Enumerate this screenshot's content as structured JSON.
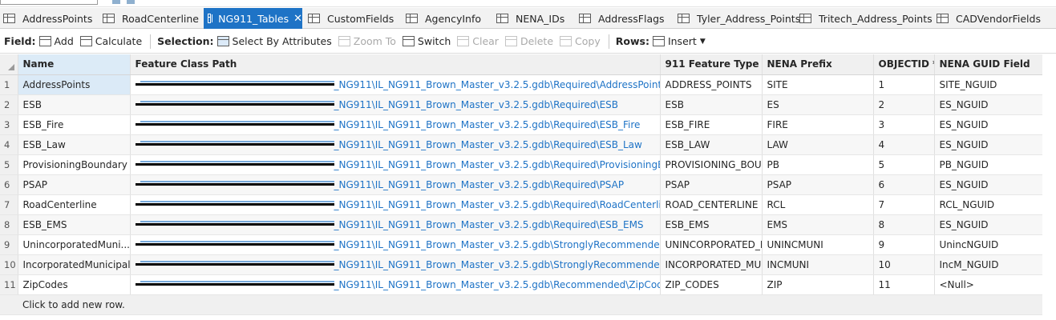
{
  "tabs": [
    {
      "label": "AddressPoints",
      "active": false
    },
    {
      "label": "RoadCenterline",
      "active": false
    },
    {
      "label": "NG911_Tables",
      "active": true,
      "close": "✕"
    },
    {
      "label": "CustomFields",
      "active": false
    },
    {
      "label": "AgencyInfo",
      "active": false
    },
    {
      "label": "NENA_IDs",
      "active": false
    },
    {
      "label": "AddressFlags",
      "active": false
    },
    {
      "label": "Tyler_Address_Points",
      "active": false
    },
    {
      "label": "Tritech_Address_Points",
      "active": false
    },
    {
      "label": "CADVendorFields",
      "active": false
    }
  ],
  "toolbar": {
    "field_label": "Field:",
    "add": "Add",
    "calculate": "Calculate",
    "selection_label": "Selection:",
    "select_by_attributes": "Select By Attributes",
    "zoom_to": "Zoom To",
    "switch": "Switch",
    "clear": "Clear",
    "delete": "Delete",
    "copy": "Copy",
    "rows_label": "Rows:",
    "insert": "Insert"
  },
  "columns": [
    "Name",
    "Feature Class Path",
    "911 Feature Type",
    "NENA Prefix",
    "OBJECTID *",
    "NENA GUID Field"
  ],
  "rows": [
    {
      "n": "1",
      "name": "AddressPoints",
      "path": "_NG911\\IL_NG911_Brown_Master_v3.2.5.gdb\\Required\\AddressPoints",
      "type": "ADDRESS_POINTS",
      "prefix": "SITE",
      "oid": "1",
      "guid": "SITE_NGUID"
    },
    {
      "n": "2",
      "name": "ESB",
      "path": "_NG911\\IL_NG911_Brown_Master_v3.2.5.gdb\\Required\\ESB",
      "type": "ESB",
      "prefix": "ES",
      "oid": "2",
      "guid": "ES_NGUID"
    },
    {
      "n": "3",
      "name": "ESB_Fire",
      "path": "_NG911\\IL_NG911_Brown_Master_v3.2.5.gdb\\Required\\ESB_Fire",
      "type": "ESB_FIRE",
      "prefix": "FIRE",
      "oid": "3",
      "guid": "ES_NGUID"
    },
    {
      "n": "4",
      "name": "ESB_Law",
      "path": "_NG911\\IL_NG911_Brown_Master_v3.2.5.gdb\\Required\\ESB_Law",
      "type": "ESB_LAW",
      "prefix": "LAW",
      "oid": "4",
      "guid": "ES_NGUID"
    },
    {
      "n": "5",
      "name": "ProvisioningBoundary",
      "path": "_NG911\\IL_NG911_Brown_Master_v3.2.5.gdb\\Required\\ProvisioningBounda",
      "type": "PROVISIONING_BOUNE",
      "prefix": "PB",
      "oid": "5",
      "guid": "PB_NGUID"
    },
    {
      "n": "6",
      "name": "PSAP",
      "path": "_NG911\\IL_NG911_Brown_Master_v3.2.5.gdb\\Required\\PSAP",
      "type": "PSAP",
      "prefix": "PSAP",
      "oid": "6",
      "guid": "ES_NGUID"
    },
    {
      "n": "7",
      "name": "RoadCenterline",
      "path": "_NG911\\IL_NG911_Brown_Master_v3.2.5.gdb\\Required\\RoadCenterline",
      "type": "ROAD_CENTERLINE",
      "prefix": "RCL",
      "oid": "7",
      "guid": "RCL_NGUID"
    },
    {
      "n": "8",
      "name": "ESB_EMS",
      "path": "_NG911\\IL_NG911_Brown_Master_v3.2.5.gdb\\Required\\ESB_EMS",
      "type": "ESB_EMS",
      "prefix": "EMS",
      "oid": "8",
      "guid": "ES_NGUID"
    },
    {
      "n": "9",
      "name": "UnincorporatedMuni...",
      "path": "_NG911\\IL_NG911_Brown_Master_v3.2.5.gdb\\StronglyRecommended\\Uninc",
      "type": "UNINCORPORATED_MU",
      "prefix": "UNINCMUNI",
      "oid": "9",
      "guid": "UnincNGUID"
    },
    {
      "n": "10",
      "name": "IncorporatedMunicipal",
      "path": "_NG911\\IL_NG911_Brown_Master_v3.2.5.gdb\\StronglyRecommended\\Incor",
      "type": "INCORPORATED_MUNI",
      "prefix": "INCMUNI",
      "oid": "10",
      "guid": "IncM_NGUID"
    },
    {
      "n": "11",
      "name": "ZipCodes",
      "path": "_NG911\\IL_NG911_Brown_Master_v3.2.5.gdb\\Recommended\\ZipCodes",
      "type": "ZIP_CODES",
      "prefix": "ZIP",
      "oid": "11",
      "guid": "<Null>"
    }
  ],
  "add_row_text": "Click to add new row.",
  "colors": {
    "accent": "#1e73c6",
    "selected_cell": "#dbeaf7",
    "header_bg": "#f0f0f0"
  }
}
